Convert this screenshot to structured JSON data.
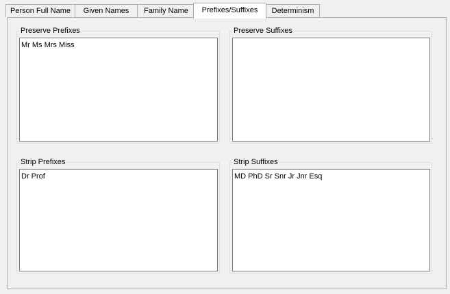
{
  "tabs": [
    {
      "label": "Person Full Name"
    },
    {
      "label": "Given Names"
    },
    {
      "label": "Family Name"
    },
    {
      "label": "Prefixes/Suffixes",
      "active": true
    },
    {
      "label": "Determinism"
    }
  ],
  "groups": {
    "preserve_prefixes": {
      "title": "Preserve Prefixes",
      "value": "Mr Ms Mrs Miss"
    },
    "preserve_suffixes": {
      "title": "Preserve Suffixes",
      "value": ""
    },
    "strip_prefixes": {
      "title": "Strip Prefixes",
      "value": "Dr Prof"
    },
    "strip_suffixes": {
      "title": "Strip Suffixes",
      "value": "MD PhD Sr Snr Jr Jnr Esq"
    }
  },
  "colors": {
    "window_background": "#f0f0f0",
    "textbox_background": "#ffffff",
    "border": "#adadad"
  }
}
